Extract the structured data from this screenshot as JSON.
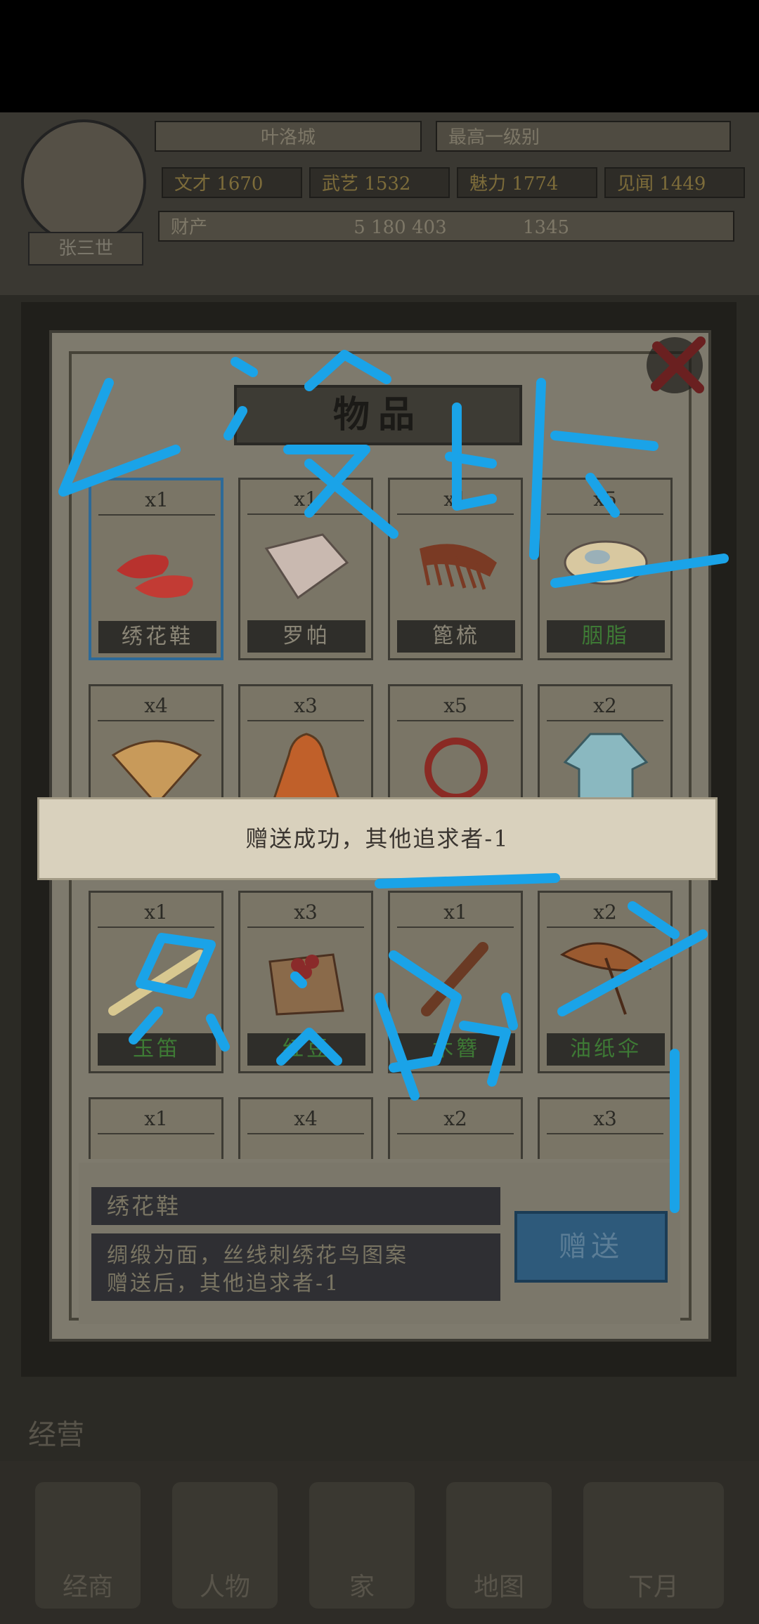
{
  "hud": {
    "player_name": "叶洛城",
    "title_badge": "最高一级别",
    "stats": [
      {
        "label": "文才",
        "value": "1670"
      },
      {
        "label": "武艺",
        "value": "1532"
      },
      {
        "label": "魅力",
        "value": "1774"
      },
      {
        "label": "见闻",
        "value": "1449"
      }
    ],
    "resources": {
      "label": "财产",
      "items": [
        "5",
        "180",
        "403"
      ],
      "other": "1345"
    },
    "avatar_tag": "张三世"
  },
  "dialog": {
    "title": "物品",
    "items": [
      {
        "qty": "x1",
        "name": "绣花鞋",
        "name_color": "normal",
        "icon": "embroidered-shoes-icon",
        "selected": true
      },
      {
        "qty": "x1",
        "name": "罗帕",
        "name_color": "normal",
        "icon": "silk-handkerchief-icon",
        "selected": false
      },
      {
        "qty": "x1",
        "name": "篦梳",
        "name_color": "normal",
        "icon": "comb-icon",
        "selected": false
      },
      {
        "qty": "x5",
        "name": "胭脂",
        "name_color": "green",
        "icon": "rouge-box-icon",
        "selected": false
      },
      {
        "qty": "x4",
        "name": "",
        "name_color": "normal",
        "icon": "folding-fan-icon",
        "selected": false
      },
      {
        "qty": "x3",
        "name": "",
        "name_color": "normal",
        "icon": "cloak-icon",
        "selected": false
      },
      {
        "qty": "x5",
        "name": "",
        "name_color": "normal",
        "icon": "bracelet-icon",
        "selected": false
      },
      {
        "qty": "x2",
        "name": "",
        "name_color": "normal",
        "icon": "dress-icon",
        "selected": false
      },
      {
        "qty": "x1",
        "name": "玉笛",
        "name_color": "green",
        "icon": "jade-flute-icon",
        "selected": false
      },
      {
        "qty": "x3",
        "name": "红豆",
        "name_color": "green",
        "icon": "red-beans-icon",
        "selected": false
      },
      {
        "qty": "x1",
        "name": "木簪",
        "name_color": "green",
        "icon": "wooden-hairpin-icon",
        "selected": false
      },
      {
        "qty": "x2",
        "name": "油纸伞",
        "name_color": "green",
        "icon": "paper-umbrella-icon",
        "selected": false
      },
      {
        "qty": "x1",
        "name": "",
        "name_color": "normal",
        "icon": "item-icon",
        "selected": false
      },
      {
        "qty": "x4",
        "name": "",
        "name_color": "normal",
        "icon": "item-icon",
        "selected": false
      },
      {
        "qty": "x2",
        "name": "",
        "name_color": "normal",
        "icon": "item-icon",
        "selected": false
      },
      {
        "qty": "x3",
        "name": "",
        "name_color": "normal",
        "icon": "item-icon",
        "selected": false
      }
    ],
    "selected_item": {
      "name": "绣花鞋",
      "description_line1": "绸缎为面，丝线刺绣花鸟图案",
      "description_line2": "赠送后，其他追求者-1"
    },
    "give_button": "赠送"
  },
  "toast": {
    "text": "赠送成功，其他追求者-1"
  },
  "nav": {
    "side_label": "经营",
    "items": [
      "经商",
      "人物",
      "家",
      "地图",
      "下月"
    ]
  },
  "annotation": {
    "line1": "没对",
    "line2": "只有一个"
  },
  "colors": {
    "accent": "#2d6a98",
    "green_text": "#3e7a35",
    "scribble": "#1aa3e8"
  }
}
